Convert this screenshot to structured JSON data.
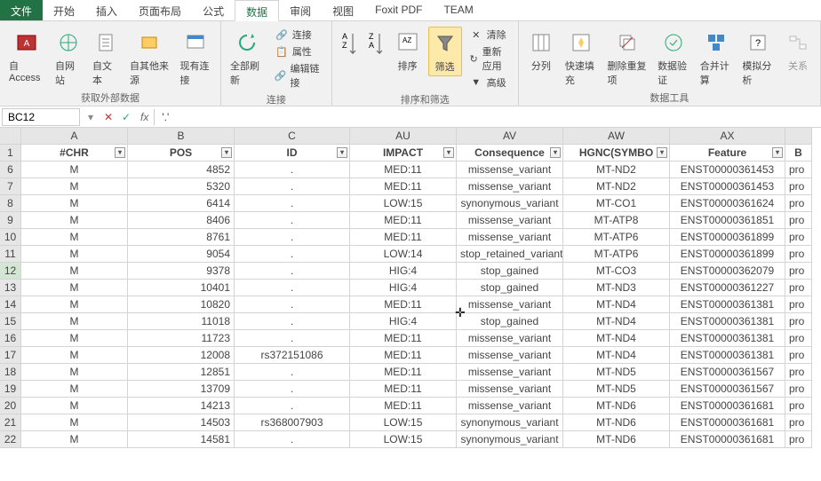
{
  "tabs": [
    "文件",
    "开始",
    "插入",
    "页面布局",
    "公式",
    "数据",
    "审阅",
    "视图",
    "Foxit PDF",
    "TEAM"
  ],
  "activeTab": "数据",
  "ribbon": {
    "groups": [
      {
        "label": "获取外部数据",
        "buttons": [
          "自 Access",
          "自网站",
          "自文本",
          "自其他来源",
          "现有连接"
        ]
      },
      {
        "label": "连接",
        "big": "全部刷新",
        "items": [
          "连接",
          "属性",
          "编辑链接"
        ]
      },
      {
        "label": "排序和筛选",
        "big1": "排序",
        "big2": "筛选",
        "items": [
          "清除",
          "重新应用",
          "高级"
        ]
      },
      {
        "label": "数据工具",
        "buttons": [
          "分列",
          "快速填充",
          "删除重复项",
          "数据验证",
          "合并计算",
          "模拟分析",
          "关系"
        ]
      }
    ]
  },
  "namebox": "BC12",
  "formula": "'.'",
  "columns": [
    {
      "letter": "A",
      "name": "#CHR",
      "w": 120
    },
    {
      "letter": "B",
      "name": "POS",
      "w": 120
    },
    {
      "letter": "C",
      "name": "ID",
      "w": 130
    },
    {
      "letter": "AU",
      "name": "IMPACT",
      "w": 120
    },
    {
      "letter": "AV",
      "name": "Consequence",
      "w": 120
    },
    {
      "letter": "AW",
      "name": "HGNC(SYMBO",
      "w": 120
    },
    {
      "letter": "AX",
      "name": "Feature",
      "w": 130
    },
    {
      "letter": "",
      "name": "B",
      "w": 30
    }
  ],
  "rowNumbers": [
    1,
    6,
    7,
    8,
    9,
    10,
    11,
    12,
    13,
    14,
    15,
    16,
    17,
    18,
    19,
    20,
    21,
    22
  ],
  "selectedRow": 12,
  "chart_data": {
    "type": "table",
    "columns": [
      "#CHR",
      "POS",
      "ID",
      "IMPACT",
      "Consequence",
      "HGNC(SYMBO",
      "Feature",
      "B"
    ],
    "rows": [
      [
        "M",
        4852,
        ".",
        "MED:11",
        "missense_variant",
        "MT-ND2",
        "ENST00000361453",
        "pro"
      ],
      [
        "M",
        5320,
        ".",
        "MED:11",
        "missense_variant",
        "MT-ND2",
        "ENST00000361453",
        "pro"
      ],
      [
        "M",
        6414,
        ".",
        "LOW:15",
        "synonymous_variant",
        "MT-CO1",
        "ENST00000361624",
        "pro"
      ],
      [
        "M",
        8406,
        ".",
        "MED:11",
        "missense_variant",
        "MT-ATP8",
        "ENST00000361851",
        "pro"
      ],
      [
        "M",
        8761,
        ".",
        "MED:11",
        "missense_variant",
        "MT-ATP6",
        "ENST00000361899",
        "pro"
      ],
      [
        "M",
        9054,
        ".",
        "LOW:14",
        "stop_retained_variant",
        "MT-ATP6",
        "ENST00000361899",
        "pro"
      ],
      [
        "M",
        9378,
        ".",
        "HIG:4",
        "stop_gained",
        "MT-CO3",
        "ENST00000362079",
        "pro"
      ],
      [
        "M",
        10401,
        ".",
        "HIG:4",
        "stop_gained",
        "MT-ND3",
        "ENST00000361227",
        "pro"
      ],
      [
        "M",
        10820,
        ".",
        "MED:11",
        "missense_variant",
        "MT-ND4",
        "ENST00000361381",
        "pro"
      ],
      [
        "M",
        11018,
        ".",
        "HIG:4",
        "stop_gained",
        "MT-ND4",
        "ENST00000361381",
        "pro"
      ],
      [
        "M",
        11723,
        ".",
        "MED:11",
        "missense_variant",
        "MT-ND4",
        "ENST00000361381",
        "pro"
      ],
      [
        "M",
        12008,
        "rs372151086",
        "MED:11",
        "missense_variant",
        "MT-ND4",
        "ENST00000361381",
        "pro"
      ],
      [
        "M",
        12851,
        ".",
        "MED:11",
        "missense_variant",
        "MT-ND5",
        "ENST00000361567",
        "pro"
      ],
      [
        "M",
        13709,
        ".",
        "MED:11",
        "missense_variant",
        "MT-ND5",
        "ENST00000361567",
        "pro"
      ],
      [
        "M",
        14213,
        ".",
        "MED:11",
        "missense_variant",
        "MT-ND6",
        "ENST00000361681",
        "pro"
      ],
      [
        "M",
        14503,
        "rs368007903",
        "LOW:15",
        "synonymous_variant",
        "MT-ND6",
        "ENST00000361681",
        "pro"
      ],
      [
        "M",
        14581,
        ".",
        "LOW:15",
        "synonymous_variant",
        "MT-ND6",
        "ENST00000361681",
        "pro"
      ]
    ]
  }
}
